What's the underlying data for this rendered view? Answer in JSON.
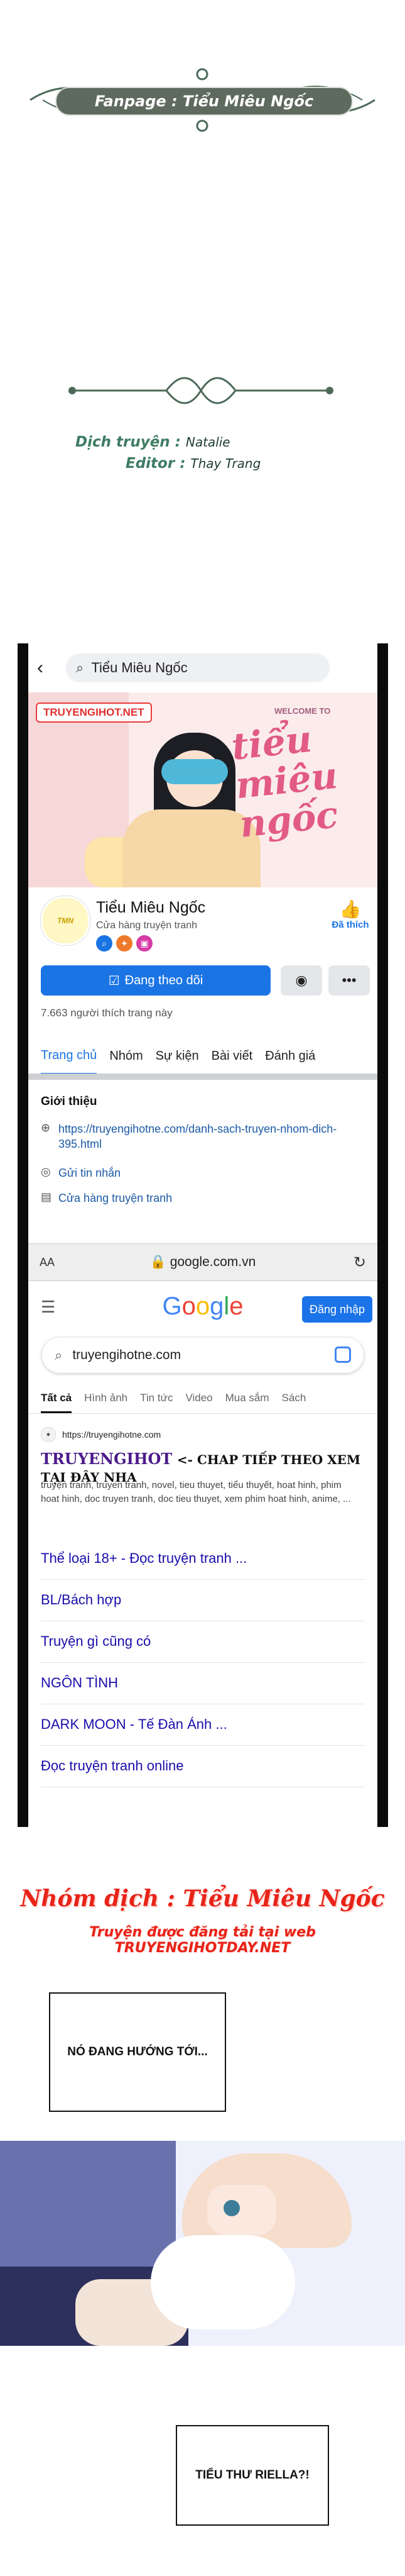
{
  "credits": {
    "fanpage": "Fanpage : Tiểu Miêu Ngốc",
    "translate_key": "Dịch truyện :",
    "translate_val": "Natalie",
    "editor_key": "Editor :",
    "editor_val": "Thay Trang"
  },
  "facebook": {
    "search_query": "Tiểu Miêu Ngốc",
    "cover_tag": "TRUYENGIHOT.NET",
    "cover_welcome": "WELCOME TO",
    "cover_script": "tiểu miêu ngốc",
    "page_name": "Tiểu Miêu Ngốc",
    "page_category": "Cửa hàng truyện tranh",
    "like_label": "Đã thích",
    "follow_label": "Đang theo dõi",
    "likes_count": "7.663 người thích trang này",
    "tabs": [
      "Trang chủ",
      "Nhóm",
      "Sự kiện",
      "Bài viết",
      "Đánh giá"
    ],
    "intro_title": "Giới thiệu",
    "intro_link": "https://truyengihotne.com/danh-sach-truyen-nhom-dich-395.html",
    "intro_message": "Gửi tin nhắn",
    "intro_shop": "Cửa hàng truyện tranh"
  },
  "browser": {
    "aa": "AA",
    "url": "google.com.vn"
  },
  "google": {
    "logo": "Google",
    "login": "Đăng nhập",
    "query": "truyengihotne.com",
    "tabs": [
      "Tất cả",
      "Hình ảnh",
      "Tin tức",
      "Video",
      "Mua sắm",
      "Sách"
    ],
    "result_url": "https://truyengihotne.com",
    "result_title_brand": "TRUYENGIHOT",
    "result_title_rest": "<- CHAP TIẾP THEO XEM TẠI ĐÂY NHA",
    "result_desc": "truyện tranh, truyen tranh, novel, tieu thuyet, tiểu thuyết, hoat hinh, phim hoat hinh, doc truyen tranh, doc tieu thuyet, xem phim hoat hinh, anime, ...",
    "sitelinks": [
      "Thể loại 18+ - Đọc truyện tranh ...",
      "BL/Bách hợp",
      "Truyện gì cũng có",
      "NGÔN TÌNH",
      "DARK MOON - Tế Đàn Ánh ...",
      "Đọc truyện tranh online"
    ]
  },
  "translator": {
    "group": "Nhóm dịch : Tiểu Miêu Ngốc",
    "upload": "Truyện được đăng tải tại web TRUYENGIHOTDAY.NET"
  },
  "comic": {
    "bubble1": "NÓ ĐANG HƯỚNG TỚI...",
    "bubble2": "TIỂU THƯ RIELLA?!"
  }
}
